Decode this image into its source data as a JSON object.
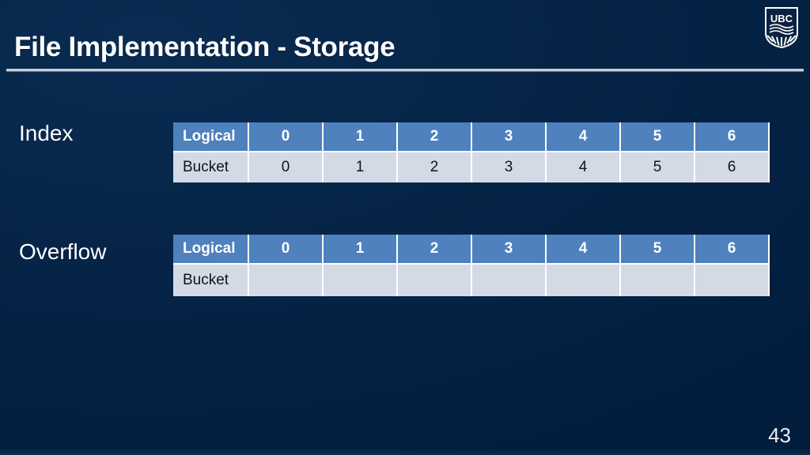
{
  "slide": {
    "title": "File Implementation - Storage",
    "number": "43",
    "logo_text": "UBC",
    "background_color": "#042246",
    "accent_color": "#4e81bd",
    "cell_color": "#d3dae6"
  },
  "sections": [
    {
      "label": "Index",
      "table": {
        "header": [
          "Logical",
          "0",
          "1",
          "2",
          "3",
          "4",
          "5",
          "6"
        ],
        "row": [
          "Bucket",
          "0",
          "1",
          "2",
          "3",
          "4",
          "5",
          "6"
        ]
      }
    },
    {
      "label": "Overflow",
      "table": {
        "header": [
          "Logical",
          "0",
          "1",
          "2",
          "3",
          "4",
          "5",
          "6"
        ],
        "row": [
          "Bucket",
          "",
          "",
          "",
          "",
          "",
          "",
          ""
        ]
      }
    }
  ]
}
